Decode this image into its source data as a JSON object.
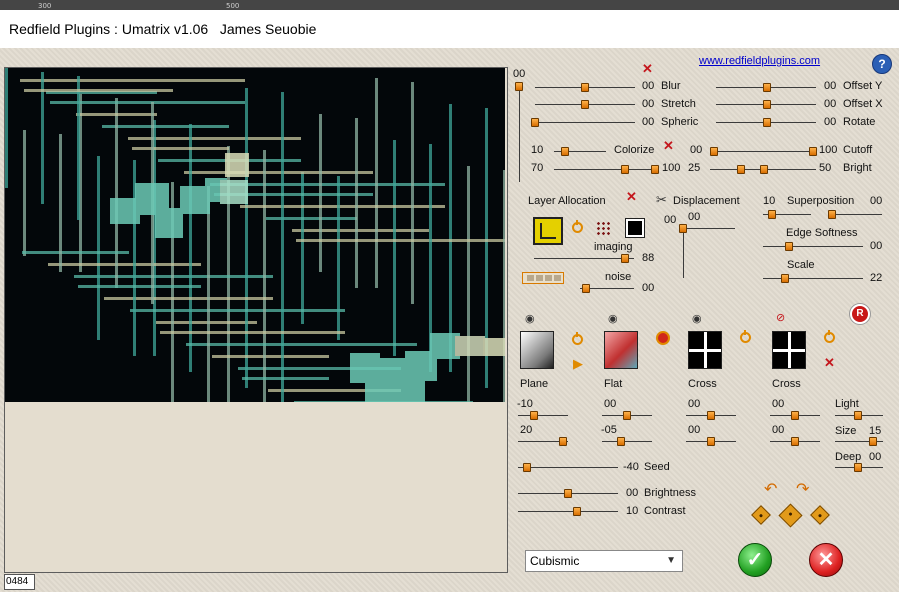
{
  "window": {
    "title": "Redfield Plugins : Umatrix v1.06   James Seuobie"
  },
  "ruler": {
    "ticks": [
      "300",
      "500"
    ]
  },
  "link": "www.redfieldplugins.com",
  "help_label": "?",
  "status_value": "0484",
  "top_left_value": "00",
  "sliders_top": [
    {
      "value": "00",
      "label": "Blur"
    },
    {
      "value": "00",
      "label": "Stretch"
    },
    {
      "value": "00",
      "label": "Spheric"
    },
    {
      "value": "00",
      "label": "Offset Y"
    },
    {
      "value": "00",
      "label": "Offset X"
    },
    {
      "value": "00",
      "label": "Rotate"
    }
  ],
  "colorize": {
    "label": "Colorize",
    "min_a": "10",
    "min_b": "70",
    "max_b": "100"
  },
  "cutoff": {
    "label": "Cutoff",
    "left": "00",
    "right": "100"
  },
  "bright": {
    "label": "Bright",
    "left": "25",
    "right": "50"
  },
  "layer": {
    "title": "Layer Allocation",
    "imaging_label": "imaging",
    "imaging_value": "88",
    "noise_label": "noise",
    "noise_value": "00"
  },
  "displacement": {
    "label": "Displacement",
    "v1": "00",
    "v2": "00"
  },
  "superposition": {
    "label": "Superposition",
    "left": "10",
    "right": "00"
  },
  "edge_softness": {
    "label": "Edge Softness",
    "value": "00"
  },
  "scale": {
    "label": "Scale",
    "value": "22"
  },
  "r_button": "R",
  "materials": [
    {
      "label": "Plane",
      "v1": "-10",
      "v2": "20"
    },
    {
      "label": "Flat",
      "v1": "00",
      "v2": "-05"
    },
    {
      "label": "Cross",
      "v1": "00",
      "v2": "00"
    },
    {
      "label": "Cross",
      "v1": "00",
      "v2": "00"
    }
  ],
  "light": {
    "label": "Light"
  },
  "size": {
    "label": "Size",
    "value": "15"
  },
  "deep": {
    "label": "Deep",
    "value": "00"
  },
  "seed": {
    "label": "Seed",
    "value": "-40"
  },
  "brightness": {
    "label": "Brightness",
    "value": "00"
  },
  "contrast": {
    "label": "Contrast",
    "value": "10"
  },
  "preset": {
    "selected": "Cubismic"
  },
  "colors": {
    "background": "#e2dcd0",
    "accent_orange": "#e08a00",
    "ok_green": "#22a022",
    "cancel_red": "#dd2020"
  }
}
